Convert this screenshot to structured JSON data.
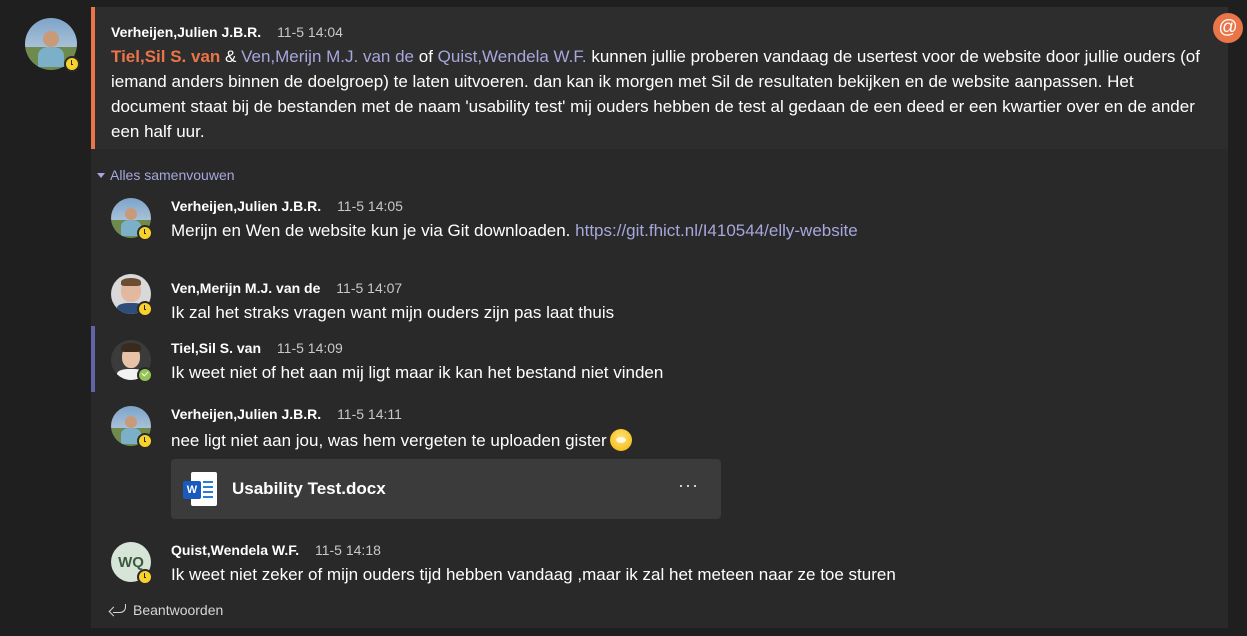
{
  "root_message": {
    "author": "Verheijen,Julien J.B.R.",
    "time": "11-5 14:04",
    "mention_1": "Tiel,Sil S. van",
    "conj_1": " & ",
    "mention_2": "Ven,Merijn M.J. van de",
    "conj_2": " of ",
    "mention_3": "Quist,Wendela W.F.",
    "text": " kunnen jullie proberen vandaag de usertest voor de website door jullie ouders (of iemand anders binnen de doelgroep) te laten uitvoeren. dan kan ik morgen met Sil de resultaten bekijken en de website aanpassen. Het document staat bij de bestanden met de naam 'usability test'  mij ouders hebben de test al gedaan de een deed er een kwartier over en de ander een half uur."
  },
  "collapse_label": "Alles samenvouwen",
  "replies": [
    {
      "author": "Verheijen,Julien J.B.R.",
      "time": "11-5 14:05",
      "text": "Merijn en Wen de website kun je via Git downloaden. ",
      "link": "https://git.fhict.nl/I410544/elly-website"
    },
    {
      "author": "Ven,Merijn M.J. van de",
      "time": "11-5 14:07",
      "text": "Ik zal het straks vragen want mijn ouders zijn pas laat thuis"
    },
    {
      "author": "Tiel,Sil S. van",
      "time": "11-5 14:09",
      "text": "Ik weet niet of het aan mij ligt maar ik kan het bestand niet vinden"
    },
    {
      "author": "Verheijen,Julien J.B.R.",
      "time": "11-5 14:11",
      "text": "nee ligt niet aan jou, was hem vergeten te uploaden gister",
      "attachment": {
        "icon_letter": "W",
        "file_name": "Usability Test.docx",
        "more": "···"
      }
    },
    {
      "author": "Quist,Wendela W.F.",
      "time": "11-5 14:18",
      "initials": "WQ",
      "text": "Ik weet niet zeker of mijn ouders tijd hebben vandaag ,maar ik zal het meteen naar ze toe sturen"
    }
  ],
  "reply_action_label": "Beantwoorden",
  "mention_badge": "@",
  "colors": {
    "accent": "#e97548",
    "link": "#a6a7dc",
    "highlight_bar": "#6264a7",
    "away": "#f8d22a",
    "online": "#92c353"
  }
}
